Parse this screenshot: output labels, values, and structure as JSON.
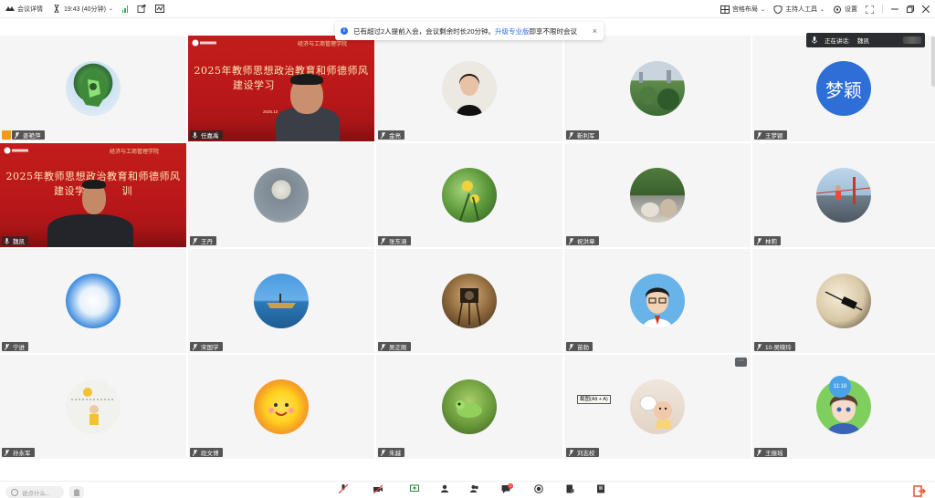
{
  "topbar": {
    "meeting_details": "会议详情",
    "time_info": "19:43 (40分钟)",
    "layout": "宫格布局",
    "host_tools": "主持人工具",
    "settings": "设置"
  },
  "notice": {
    "text": "已有超过2人提前入会，会议剩余时长20分钟。",
    "link": "升级专业版",
    "suffix": "即享不限时会议"
  },
  "speaking": {
    "label": "正在讲话:",
    "name": "魏凯"
  },
  "slide": {
    "school": "经济与工商管理学院",
    "title_line1": "2025年教师思想政治教育和师德师风",
    "title_line2_a": "建设学习",
    "title_line2_b": "建设学",
    "title_line2_c": "训",
    "date": "2025.12"
  },
  "participants": [
    {
      "name": "姜艳萍",
      "avatar": "green-robot"
    },
    {
      "name": "任嘉禹",
      "avatar": "slide-video"
    },
    {
      "name": "金亮",
      "avatar": "woman-photo"
    },
    {
      "name": "靳利军",
      "avatar": "landscape"
    },
    {
      "name": "王梦颖",
      "avatar": "text-avatar",
      "avatar_text": "梦颖",
      "avatar_color": "#2d6fd6"
    },
    {
      "name": "魏凯",
      "avatar": "slide-video-active"
    },
    {
      "name": "王丹",
      "avatar": "moon"
    },
    {
      "name": "张东涵",
      "avatar": "plant"
    },
    {
      "name": "祝洪章",
      "avatar": "cat-scene"
    },
    {
      "name": "林莉",
      "avatar": "bridge-runner"
    },
    {
      "name": "宁进",
      "avatar": "clouds"
    },
    {
      "name": "宋国学",
      "avatar": "boat"
    },
    {
      "name": "吴正刚",
      "avatar": "camera"
    },
    {
      "name": "苗勃",
      "avatar": "cartoon-boy"
    },
    {
      "name": "10-吴晓玲",
      "avatar": "clock"
    },
    {
      "name": "孙永军",
      "avatar": "volleyball"
    },
    {
      "name": "段文博",
      "avatar": "sun-cartoon"
    },
    {
      "name": "朱越",
      "avatar": "lizard"
    },
    {
      "name": "刘志校",
      "avatar": "baby-cat"
    },
    {
      "name": "王振瑶",
      "avatar": "anime-girl"
    }
  ],
  "overlays": {
    "more": "···",
    "tooltip": "截图(Alt + A)",
    "timer": "11:18"
  },
  "bottombar": {
    "chat_placeholder": "说点什么...",
    "chat_badge": "1",
    "tools": [
      "icon-1",
      "icon-2",
      "icon-3",
      "icon-4",
      "icon-5",
      "icon-6",
      "icon-7",
      "icon-8",
      "icon-9"
    ]
  },
  "colors": {
    "slide_red": "#c21d1b",
    "active_border": "#3fd07a",
    "accent_blue": "#2f6fe3",
    "host_badge": "#f39a17"
  }
}
